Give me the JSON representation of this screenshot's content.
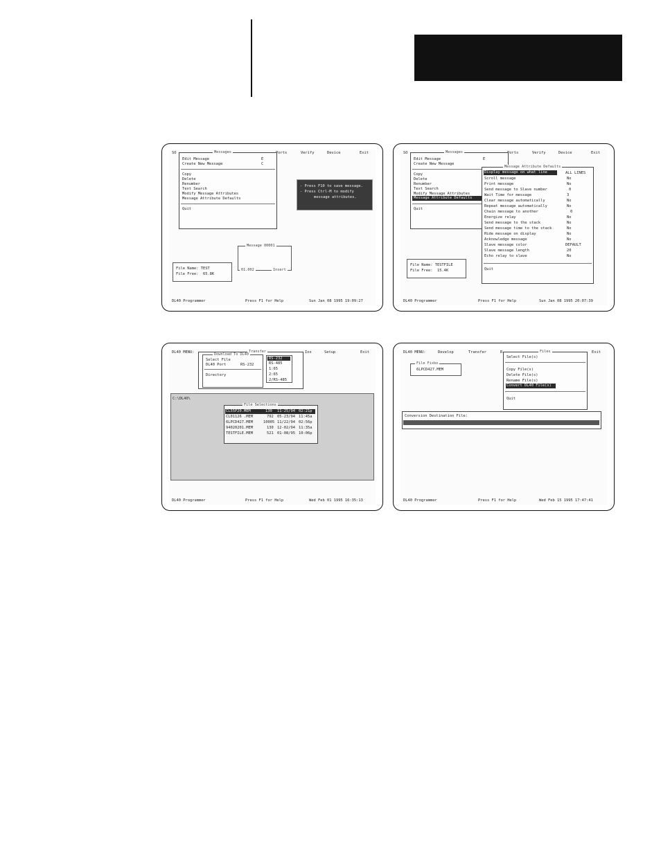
{
  "screens": {
    "s1": {
      "menubar": {
        "left": "SO",
        "mid": "Messages",
        "ports": "Ports",
        "verify": "Verify",
        "device": "Device",
        "exit": "Exit"
      },
      "menu": [
        {
          "label": "Edit Message",
          "key": "E"
        },
        {
          "label": "Create New Message",
          "key": "C"
        },
        {
          "label": "Copy"
        },
        {
          "label": "Delete"
        },
        {
          "label": "Renumber"
        },
        {
          "label": "Text Search"
        },
        {
          "label": "Modify Message Attributes"
        },
        {
          "label": "Message Attribute Defaults"
        },
        {
          "label": "Quit"
        }
      ],
      "hint": [
        "- Press F10 to save message.",
        "- Press Ctrl-M to modify",
        "message attributes."
      ],
      "msgbox": {
        "title": "Message 00001",
        "bottom_left": "01.002",
        "bottom_right": "Insert"
      },
      "file": {
        "name": "File Name: TEST",
        "free": "File Free:  65.8K"
      },
      "status": {
        "left": "DL40 Programmer",
        "mid": "Press F1 for Help",
        "right": "Sun Jan 08 1995 19:09:27"
      }
    },
    "s2": {
      "menubar": {
        "left": "SO",
        "mid": "Messages",
        "ports": "Ports",
        "verify": "Verify",
        "device": "Device",
        "exit": "Exit"
      },
      "menu": [
        {
          "label": "Edit Message",
          "key": "E"
        },
        {
          "label": "Create New Message"
        },
        {
          "label": "Copy"
        },
        {
          "label": "Delete"
        },
        {
          "label": "Renumber"
        },
        {
          "label": "Text Search"
        },
        {
          "label": "Modify Message Attributes"
        },
        {
          "label": "Message Attribute Defaults"
        },
        {
          "label": "Quit"
        }
      ],
      "defaults_title": "Message Attribute Defaults",
      "defaults": [
        {
          "k": "Display message on what line",
          "v": "ALL LINES"
        },
        {
          "k": "Scroll message",
          "v": "No"
        },
        {
          "k": "Print message",
          "v": "No"
        },
        {
          "k": "Send message to Slave number",
          "v": "0"
        },
        {
          "k": "Wait Time for message",
          "v": "3"
        },
        {
          "k": "Clear message automatically",
          "v": "No"
        },
        {
          "k": "Repeat message automatically",
          "v": "No"
        },
        {
          "k": "Chain message to another",
          "v": "0"
        },
        {
          "k": "Energize relay",
          "v": "No"
        },
        {
          "k": "Send message to the stack",
          "v": "No"
        },
        {
          "k": "Send message time to the stack",
          "v": "No"
        },
        {
          "k": "Hide message on display",
          "v": "No"
        },
        {
          "k": "Acknowledge message",
          "v": "No"
        },
        {
          "k": "Slave message color",
          "v": "DEFAULT"
        },
        {
          "k": "Slave message length",
          "v": "20"
        },
        {
          "k": "Echo relay to slave",
          "v": "No"
        }
      ],
      "quit": "Quit",
      "file": {
        "name": "File Name: TESTFILE",
        "free": "File Free:  15.4K"
      },
      "status": {
        "left": "DL40 Programmer",
        "mid": "Press F1 for Help",
        "right": "Sun Jan 08 1995 20:07:39"
      }
    },
    "s3": {
      "menubar": {
        "left": "DL40 MENU:",
        "mid": "Transfer",
        "ios": "Ios",
        "setup": "Setup",
        "exit": "Exit"
      },
      "download_title": "Download To DL40",
      "menu": [
        {
          "label": "Select File"
        },
        {
          "label": "DL40 Port",
          "value": "RS-232"
        },
        {
          "label": "Directory"
        }
      ],
      "ports": [
        "RS-232",
        "RS-485",
        "1:65",
        "2:65",
        "2/RS-485"
      ],
      "path": "C:\\DL40\\",
      "files_title": "File Selections",
      "files": [
        {
          "name": "CL55P20.MEM",
          "size": "130",
          "date": "11-25/94",
          "time": "02:21p"
        },
        {
          "name": "CL01126 .MEM",
          "size": "792",
          "date": "05-23/94",
          "time": "11:45a"
        },
        {
          "name": "6LPCD427.MEM",
          "size": "10005",
          "date": "11/22/94",
          "time": "02:56p"
        },
        {
          "name": "94020201.MEM",
          "size": "130",
          "date": "12-02/94",
          "time": "11:35a"
        },
        {
          "name": "TESTFILE.MEM",
          "size": "521",
          "date": "01-08/95",
          "time": "10:06p"
        }
      ],
      "status": {
        "left": "DL40 Programmer",
        "mid": "Press F1 for Help",
        "right": "Wed Feb 01 1995 16:35:13"
      }
    },
    "s4": {
      "menubar": {
        "left": "DL40 MENU:",
        "develop": "Develop",
        "transfer": "Transfer",
        "r": "R",
        "mid": "Files",
        "exit": "Exit"
      },
      "fixbox": {
        "title": "File Fixbo",
        "file": "6LPCD427.MEM"
      },
      "menu": [
        {
          "label": "Select File(s)"
        },
        {
          "label": "Copy File(s)"
        },
        {
          "label": "Delete File(s)"
        },
        {
          "label": "Rename File(s)"
        },
        {
          "label": "Convert DL40 File(s)"
        },
        {
          "label": "Quit"
        }
      ],
      "dest_label": "Conversion Destination File:",
      "status": {
        "left": "DL40 Programmer",
        "mid": "Press F1 for Help",
        "right": "Wed Feb 15 1995 17:47:41"
      }
    }
  }
}
